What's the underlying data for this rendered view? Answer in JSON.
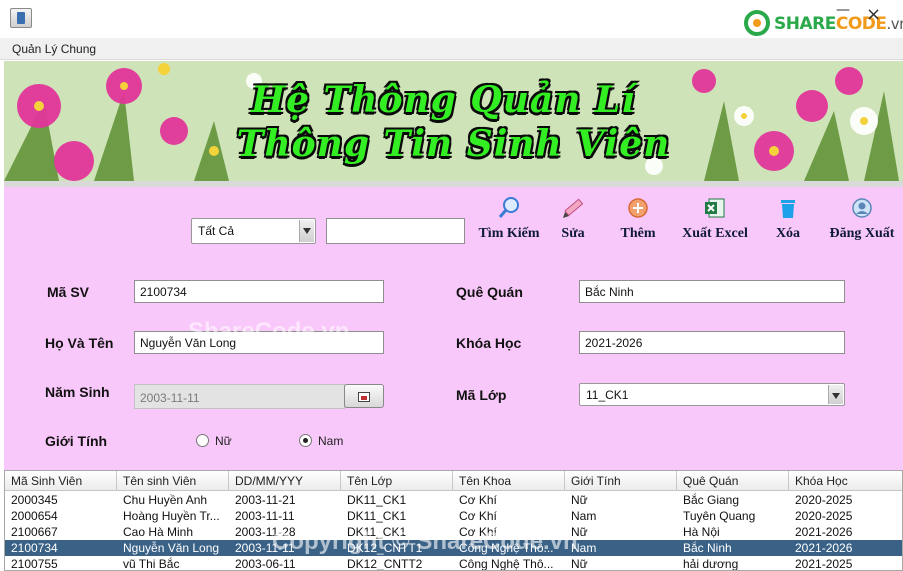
{
  "window": {
    "brand": {
      "part1": "SHARE",
      "part2": "CODE",
      "part3": ".vn"
    },
    "minimize": "—",
    "close": "×"
  },
  "menubar": {
    "items": [
      "Quản Lý Chung"
    ]
  },
  "banner": {
    "line1": "Hệ Thông Quản Lí",
    "line2": "Thông Tin Sinh Viên"
  },
  "search": {
    "filter_value": "Tất Cả",
    "query": ""
  },
  "toolbar": {
    "search": "Tìm Kiếm",
    "edit": "Sửa",
    "add": "Thêm",
    "export": "Xuất Excel",
    "delete": "Xóa",
    "logout": "Đăng Xuất"
  },
  "form": {
    "student_id": {
      "label": "Mã SV",
      "value": "2100734"
    },
    "full_name": {
      "label": "Họ Và Tên",
      "value": "Nguyễn Văn Long"
    },
    "birth_year": {
      "label": "Năm Sinh",
      "value": "2003-11-11"
    },
    "gender": {
      "label": "Giới Tính",
      "options": [
        "Nữ",
        "Nam"
      ],
      "selected": "Nam"
    },
    "hometown": {
      "label": "Quê Quán",
      "value": "Bắc Ninh"
    },
    "course": {
      "label": "Khóa Học",
      "value": "2021-2026"
    },
    "class_code": {
      "label": "Mã Lớp",
      "value": "11_CK1"
    }
  },
  "table": {
    "columns": [
      "Mã Sinh Viên",
      "Tên sinh Viên",
      "DD/MM/YYY",
      "Tên Lớp",
      "Tên Khoa",
      "Giới Tính",
      "Quê Quán",
      "Khóa Học"
    ],
    "rows": [
      [
        "2000345",
        "Chu Huyền Anh",
        "2003-11-21",
        "DK11_CK1",
        "Cơ Khí",
        "Nữ",
        "Bắc Giang",
        "2020-2025"
      ],
      [
        "2000654",
        "Hoàng Huyền Tr...",
        "2003-11-11",
        "DK11_CK1",
        "Cơ Khí",
        "Nam",
        "Tuyên Quang",
        "2020-2025"
      ],
      [
        "2100667",
        "Cao Hà Minh",
        "2003-11-28",
        "DK11_CK1",
        "Cơ Khí",
        "Nữ",
        "Hà Nội",
        "2021-2026"
      ],
      [
        "2100734",
        "Nguyễn Văn Long",
        "2003-11-11",
        "DK12_CNTT1",
        "Công Nghệ Thô...",
        "Nam",
        "Bắc Ninh",
        "2021-2026"
      ],
      [
        "2100755",
        "vũ Thi Bắc",
        "2003-06-11",
        "DK12_CNTT2",
        "Công Nghệ Thô...",
        "Nữ",
        "hải dương",
        "2021-2025"
      ]
    ],
    "selected_row": 3
  },
  "watermarks": {
    "center": "ShareCode.vn",
    "bottom": "Copyright © ShareCode.vn"
  },
  "colors": {
    "panel": "#f9c8fa",
    "selection": "#3a6186",
    "title_green": "#33ee22"
  }
}
